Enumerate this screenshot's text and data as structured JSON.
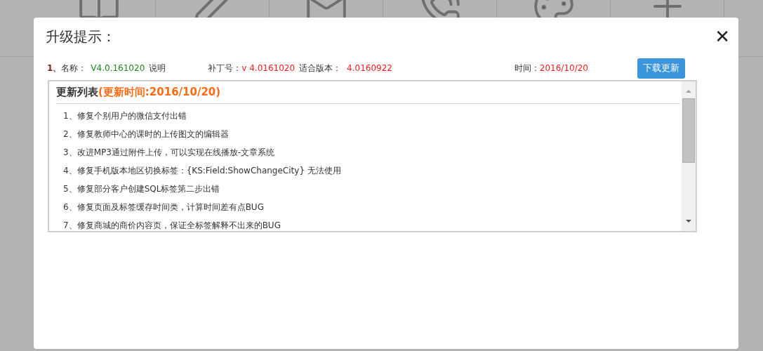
{
  "dialog": {
    "title": "升级提示：",
    "close": "✕"
  },
  "update": {
    "index": "1、",
    "name_label": "名称：",
    "name_value": "V4.0.161020",
    "name_note": "说明",
    "patch_label": "补丁号：",
    "patch_value": "v 4.0161020",
    "fit_label": "适合版本：",
    "fit_value": "4.0160922",
    "time_label": "时间：",
    "time_value": "2016/10/20",
    "button": "下载更新"
  },
  "changelog": {
    "heading": "更新列表",
    "heading_time": "(更新时间:2016/10/20)",
    "items": [
      "1、修复个别用户的微信支付出错",
      "2、修复教师中心的课时的上传图文的编辑器",
      "3、改进MP3通过附件上传，可以实现在线播放-文章系统",
      "4、修复手机版本地区切换标签：{KS:Field:ShowChangeCity} 无法使用",
      "5、修复部分客户创建SQL标签第二步出错",
      "6、修复页面及标签缓存时间类，计算时间差有点BUG",
      "7、修复商城的商价内容页，保证全标签解释不出来的BUG"
    ]
  }
}
